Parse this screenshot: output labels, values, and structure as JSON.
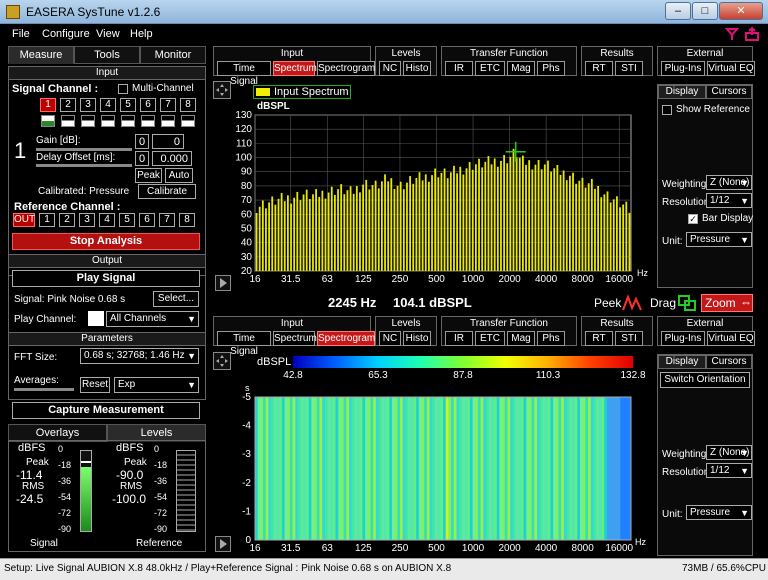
{
  "window": {
    "title": "EASERA SysTune v1.2.6"
  },
  "menu": [
    "File",
    "Configure",
    "View",
    "Help"
  ],
  "left": {
    "tabs": [
      "Measure",
      "Tools",
      "Monitor"
    ],
    "input_header": "Input",
    "signal_channel_label": "Signal Channel :",
    "multichannel_label": "Multi-Channel",
    "channels": [
      "1",
      "2",
      "3",
      "4",
      "5",
      "6",
      "7",
      "8"
    ],
    "channel_number": "1",
    "gain_label": "Gain [dB]:",
    "gain_value": "0",
    "gain_value2": "0",
    "delay_label": "Delay Offset [ms]:",
    "delay_value": "0",
    "delay_value2": "0.000",
    "peak_label": "Peak",
    "auto_label": "Auto",
    "calibrated_label": "Calibrated: Pressure",
    "calibrate_btn": "Calibrate",
    "ref_channel_label": "Reference Channel :",
    "ref_channels": [
      "OUT",
      "1",
      "2",
      "3",
      "4",
      "5",
      "6",
      "7",
      "8"
    ],
    "stop_btn": "Stop Analysis",
    "output_header": "Output",
    "play_btn": "Play Signal",
    "signal_text": "Signal: Pink Noise  0.68 s",
    "select_btn": "Select...",
    "play_channel_label": "Play Channel:",
    "play_channel_value": "All Channels",
    "params_header": "Parameters",
    "fft_label": "FFT Size:",
    "fft_value": "0.68 s; 32768; 1.46 Hz",
    "averages_label": "Averages:",
    "reset_btn": "Reset",
    "avg_value": "Exp",
    "capture_btn": "Capture Measurement",
    "bottom_tabs": [
      "Overlays",
      "Levels"
    ],
    "sig": {
      "unit": "dBFS",
      "peak_label": "Peak",
      "peak": "-11.4",
      "rms_label": "RMS",
      "rms": "-24.5",
      "name": "Signal"
    },
    "ref": {
      "unit": "dBFS",
      "peak_label": "Peak",
      "peak": "-90.0",
      "rms_label": "RMS",
      "rms": "-100.0",
      "name": "Reference"
    },
    "meter_ticks": [
      "0",
      "-18",
      "-36",
      "-54",
      "-72",
      "-90"
    ]
  },
  "toolbar": {
    "groups": [
      {
        "title": "Input",
        "buttons": [
          "Time Signal",
          "Spectrum",
          "Spectrogram"
        ]
      },
      {
        "title": "Levels",
        "buttons": [
          "NC",
          "Histo"
        ]
      },
      {
        "title": "Transfer Function",
        "buttons": [
          "IR",
          "ETC",
          "Mag",
          "Phs"
        ]
      },
      {
        "title": "Results",
        "buttons": [
          "RT",
          "STI"
        ]
      },
      {
        "title": "External",
        "buttons": [
          "Plug-Ins",
          "Virtual EQ"
        ]
      }
    ]
  },
  "spectrum": {
    "legend": "Input Spectrum",
    "ylabel": "dBSPL",
    "yticks": [
      "130",
      "120",
      "110",
      "100",
      "90",
      "80",
      "70",
      "60",
      "50",
      "40",
      "30",
      "20"
    ],
    "xticks": [
      "16",
      "31.5",
      "63",
      "125",
      "250",
      "500",
      "1000",
      "2000",
      "4000",
      "8000",
      "16000"
    ],
    "xunit": "Hz",
    "readout_freq": "2245 Hz",
    "readout_level": "104.1 dBSPL",
    "peek_label": "Peek",
    "drag_label": "Drag",
    "zoom_label": "Zoom",
    "legend_color": "#f0f000"
  },
  "spectrogram": {
    "ylabel": "dBSPL",
    "scale": [
      "42.8",
      "65.3",
      "87.8",
      "110.3",
      "132.8"
    ],
    "yaxis_unit": "s",
    "yticks": [
      "-5",
      "-4",
      "-3",
      "-2",
      "-1",
      "0"
    ],
    "xticks": [
      "16",
      "31.5",
      "63",
      "125",
      "250",
      "500",
      "1000",
      "2000",
      "4000",
      "8000",
      "16000"
    ],
    "xunit": "Hz"
  },
  "right_top": {
    "tabs": [
      "Display",
      "Cursors"
    ],
    "show_ref": "Show Reference",
    "weighting_label": "Weighting:",
    "weighting": "Z (None)",
    "resolution_label": "Resolution:",
    "resolution": "1/12",
    "bar_display": "Bar Display",
    "unit_label": "Unit:",
    "unit": "Pressure"
  },
  "right_bottom": {
    "tabs": [
      "Display",
      "Cursors"
    ],
    "switch_btn": "Switch Orientation",
    "weighting_label": "Weighting:",
    "weighting": "Z (None)",
    "resolution_label": "Resolution:",
    "resolution": "1/12",
    "unit_label": "Unit:",
    "unit": "Pressure"
  },
  "status": {
    "left": "Setup: Live Signal AUBION X.8 48.0kHz / Play+Reference Signal : Pink Noise  0.68 s on AUBION X.8",
    "right": "73MB / 65.6%CPU"
  },
  "chart_data": [
    {
      "type": "bar",
      "title": "Input Spectrum",
      "ylabel": "dBSPL",
      "xlabel": "Hz",
      "ylim": [
        20,
        130
      ],
      "xscale": "log",
      "xlim": [
        16,
        20000
      ],
      "x": [
        16,
        20,
        25,
        31.5,
        40,
        50,
        63,
        80,
        100,
        125,
        160,
        200,
        250,
        315,
        400,
        500,
        630,
        800,
        1000,
        1250,
        1600,
        2000,
        2245,
        2500,
        3150,
        4000,
        5000,
        6300,
        8000,
        10000,
        12500,
        16000,
        20000
      ],
      "values": [
        65,
        68,
        70,
        72,
        74,
        73,
        76,
        78,
        75,
        82,
        80,
        85,
        80,
        84,
        86,
        90,
        88,
        92,
        95,
        96,
        98,
        100,
        104,
        97,
        96,
        95,
        90,
        88,
        82,
        80,
        74,
        68,
        62
      ]
    },
    {
      "type": "heatmap",
      "ylabel": "s",
      "xlabel": "Hz",
      "colorbar_label": "dBSPL",
      "clim": [
        42.8,
        132.8
      ],
      "ylim": [
        -5,
        0
      ],
      "xscale": "log",
      "xlim": [
        16,
        20000
      ]
    }
  ]
}
